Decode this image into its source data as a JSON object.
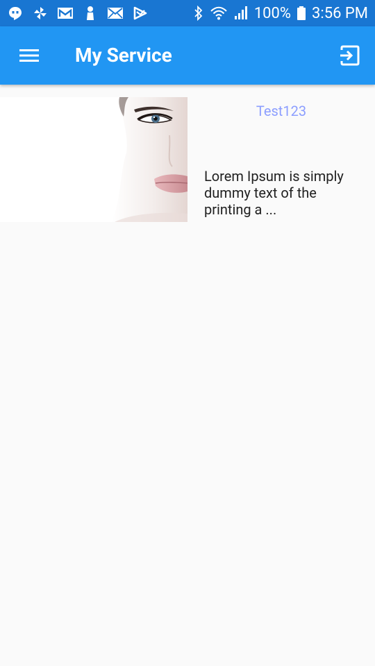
{
  "status_bar": {
    "battery_text": "100%",
    "time": "3:56 PM",
    "left_icons": [
      "hangouts-icon",
      "pinwheel-icon",
      "gmail-icon",
      "person-icon",
      "mail-icon",
      "play-store-icon"
    ],
    "right_icons": [
      "bluetooth-icon",
      "wifi-icon",
      "signal-icon",
      "battery-icon"
    ]
  },
  "app_bar": {
    "title": "My Service",
    "menu_icon": "hamburger-menu-icon",
    "logout_icon": "exit-to-app-icon"
  },
  "services": [
    {
      "title": "Test123",
      "description": "Lorem Ipsum is simply dummy text of the printing a ..."
    }
  ],
  "colors": {
    "status_bar": "#1976D2",
    "app_bar": "#2196F3",
    "background": "#FAFAFA",
    "title_accent": "#8C9EFF",
    "body_text": "#212121"
  }
}
